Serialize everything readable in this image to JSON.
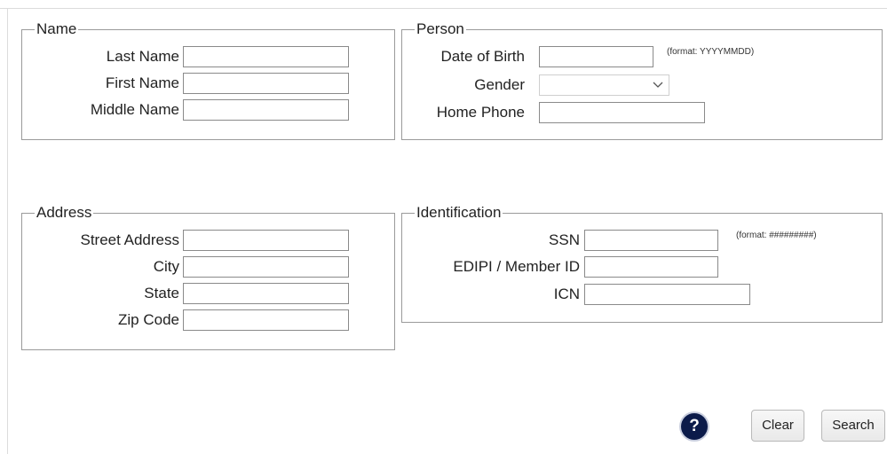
{
  "name_group": {
    "legend": "Name",
    "fields": [
      {
        "label": "Last Name",
        "value": ""
      },
      {
        "label": "First Name",
        "value": ""
      },
      {
        "label": "Middle Name",
        "value": ""
      }
    ]
  },
  "person_group": {
    "legend": "Person",
    "dob": {
      "label": "Date of Birth",
      "value": "",
      "hint": "(format: YYYYMMDD)"
    },
    "gender": {
      "label": "Gender",
      "selected": ""
    },
    "phone": {
      "label": "Home Phone",
      "value": ""
    }
  },
  "address_group": {
    "legend": "Address",
    "fields": [
      {
        "label": "Street Address",
        "value": ""
      },
      {
        "label": "City",
        "value": ""
      },
      {
        "label": "State",
        "value": ""
      },
      {
        "label": "Zip Code",
        "value": ""
      }
    ]
  },
  "identification_group": {
    "legend": "Identification",
    "ssn": {
      "label": "SSN",
      "value": "",
      "hint": "(format: #########)"
    },
    "edipi": {
      "label": "EDIPI / Member ID",
      "value": ""
    },
    "icn": {
      "label": "ICN",
      "value": ""
    }
  },
  "actions": {
    "help_label": "?",
    "clear_label": "Clear",
    "search_label": "Search"
  },
  "icons": {
    "help": "question-circle-icon",
    "dropdown": "chevron-down-icon"
  },
  "colors": {
    "help_button_bg": "#0c1b4a",
    "fieldset_border": "#9a9a9a"
  }
}
